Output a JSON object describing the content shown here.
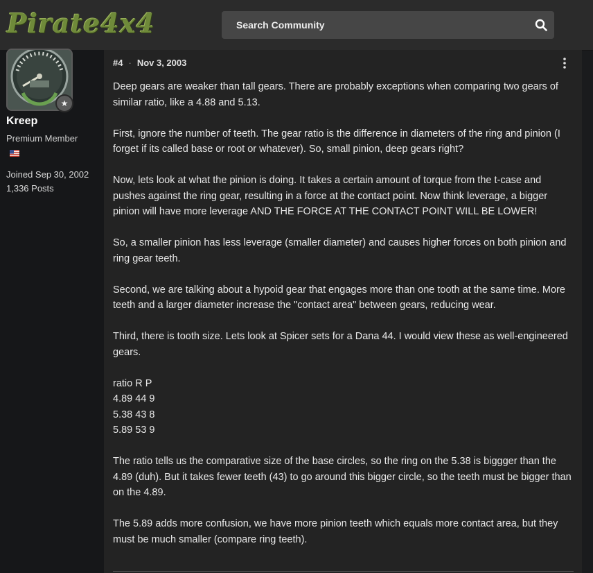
{
  "header": {
    "logo_text": "Pirate4x4",
    "search_placeholder": "Search Community",
    "icons": {
      "search": "search-icon"
    }
  },
  "user": {
    "name": "Kreep",
    "role": "Premium Member",
    "flag": "us-flag-icon",
    "joined": "Joined Sep 30, 2002",
    "posts": "1,336 Posts",
    "badge_icon": "star-icon"
  },
  "post": {
    "number": "#4",
    "separator": "·",
    "date": "Nov 3, 2003",
    "paragraphs": [
      "Deep gears are weaker than tall gears. There are probably exceptions when comparing two gears of similar ratio, like a 4.88 and 5.13.",
      "First, ignore the number of teeth. The gear ratio is the difference in diameters of the ring and pinion (I forget if its called base or root or whatever). So, small pinion, deep gears right?",
      "Now, lets look at what the pinion is doing. It takes a certain amount of torque from the t-case and pushes against the ring gear, resulting in a force at the contact point. Now think leverage, a bigger pinion will have more leverage AND THE FORCE AT THE CONTACT POINT WILL BE LOWER!",
      "So, a smaller pinion has less leverage (smaller diameter) and causes higher forces on both pinion and ring gear teeth.",
      "Second, we are talking about a hypoid gear that engages more than one tooth at the same time. More teeth and a larger diameter increase the \"contact area\" between gears, reducing wear.",
      "Third, there is tooth size. Lets look at Spicer sets for a Dana 44. I would view these as well-engineered gears.",
      "ratio R P\n4.89 44 9\n5.38 43 8\n5.89 53 9",
      "The ratio tells us the comparative size of the base circles, so the ring on the 5.38 is biggger than the 4.89 (duh). But it takes fewer teeth (43) to go around this bigger circle, so the teeth must be bigger than on the 4.89.",
      "The 5.89 adds more confusion, we have more pinion teeth which equals more contact area, but they must be much smaller (compare ring teeth)."
    ]
  },
  "colors": {
    "accent_logo": "#6f8a3a",
    "header_bg": "#2b2b2b",
    "sidebar_bg": "#161719",
    "post_bg": "#232323",
    "search_bg": "#464646"
  }
}
